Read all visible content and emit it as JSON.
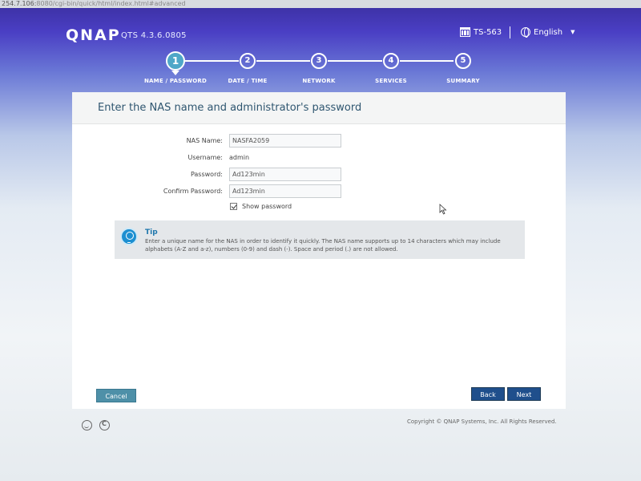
{
  "browser": {
    "url_host": "254.7.106:",
    "url_rest": "8080/cgi-bin/quick/html/index.html#advanced"
  },
  "header": {
    "logo": "QNAP",
    "version": "QTS 4.3.6.0805",
    "model": "TS-563",
    "language": "English"
  },
  "steps": [
    {
      "number": "1",
      "label": "NAME / PASSWORD",
      "active": true
    },
    {
      "number": "2",
      "label": "DATE / TIME",
      "active": false
    },
    {
      "number": "3",
      "label": "NETWORK",
      "active": false
    },
    {
      "number": "4",
      "label": "SERVICES",
      "active": false
    },
    {
      "number": "5",
      "label": "SUMMARY",
      "active": false
    }
  ],
  "panel": {
    "title": "Enter the NAS name and administrator's password",
    "form": {
      "nas_name_label": "NAS Name:",
      "nas_name_value": "NASFA2059",
      "username_label": "Username:",
      "username_value": "admin",
      "password_label": "Password:",
      "password_value": "Ad123min",
      "confirm_label": "Confirm Password:",
      "confirm_value": "Ad123min",
      "show_password_label": "Show password",
      "show_password_checked": true
    },
    "tip": {
      "title": "Tip",
      "text": "Enter a unique name for the NAS in order to identify it quickly. The NAS name supports up to 14 characters which may include alphabets (A-Z and a-z), numbers (0-9) and dash (-). Space and period (.) are not allowed."
    },
    "buttons": {
      "cancel": "Cancel",
      "back": "Back",
      "next": "Next"
    }
  },
  "footer": {
    "copyright": "Copyright © QNAP Systems, Inc. All Rights Reserved."
  },
  "colors": {
    "accent": "#1f4f8c",
    "step_active": "#4fa7c8",
    "title_text": "#2f5670"
  }
}
